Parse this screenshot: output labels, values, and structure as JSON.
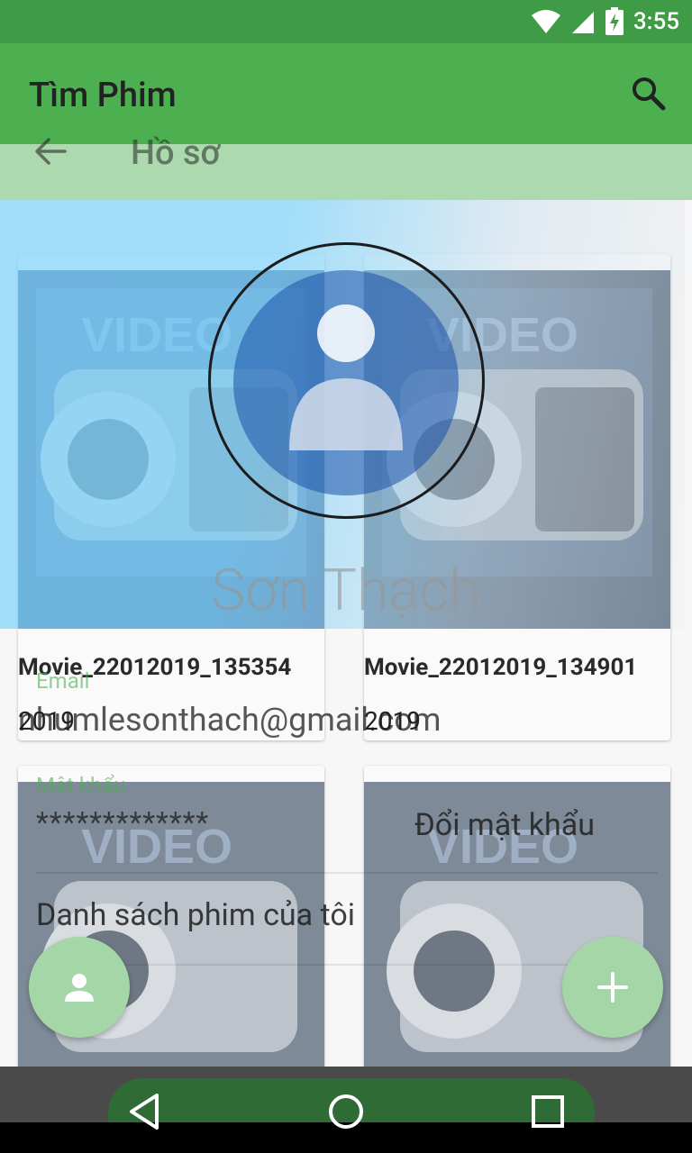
{
  "status": {
    "time": "3:55"
  },
  "appbar": {
    "title": "Tìm Phim"
  },
  "movies": [
    {
      "title": "Movie_22012019_135354",
      "year": "2019"
    },
    {
      "title": "Movie_22012019_134901",
      "year": "2019"
    },
    {
      "title": "",
      "year": ""
    },
    {
      "title": "",
      "year": ""
    }
  ],
  "profile": {
    "title": "Hồ sơ",
    "name": "Sơn Thạch",
    "email_label": "Email",
    "email_value": "nhumlesonthach@gmail.com",
    "password_label": "Mật khẩu",
    "password_value": "*************",
    "change_password": "Đổi mật khẩu",
    "my_movies": "Danh sách phim của tôi"
  },
  "colors": {
    "primary": "#4caf50",
    "primary_dark": "#3f9b45",
    "accent_fab": "#a5d6a7"
  }
}
